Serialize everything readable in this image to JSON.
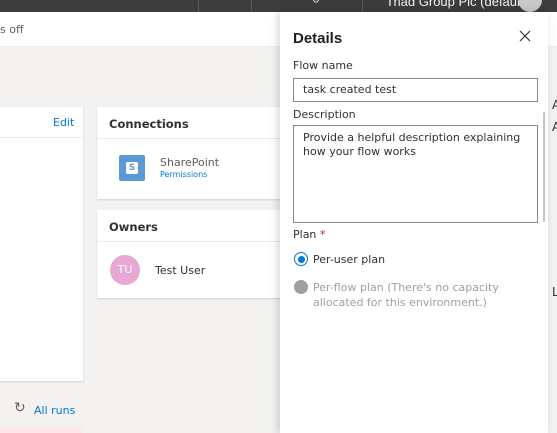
{
  "header": {
    "tenant": "Triad Group Plc (default)",
    "settings_icon": "gear-icon"
  },
  "command_bar": {
    "partial_text": "s off"
  },
  "details_card": {
    "edit_label": "Edit"
  },
  "runs": {
    "all_runs_label": "All runs",
    "refresh_icon": "refresh-icon"
  },
  "connections": {
    "title": "Connections",
    "items": [
      {
        "name": "SharePoint",
        "link": "Permissions",
        "icon": "sharepoint-icon",
        "color": "#5b9bd5"
      }
    ]
  },
  "owners": {
    "title": "Owners",
    "items": [
      {
        "initials": "TU",
        "name": "Test User",
        "color": "#e9a7d3"
      }
    ]
  },
  "edge_fragments": [
    "A",
    "A",
    "L"
  ],
  "panel": {
    "title": "Details",
    "close_icon": "close-icon",
    "flow_name_label": "Flow name",
    "flow_name_value": "task created test",
    "description_label": "Description",
    "description_placeholder": "Provide a helpful description explaining how your flow works",
    "plan_label": "Plan",
    "plan_required": "*",
    "plan_options": [
      {
        "label": "Per-user plan",
        "selected": true,
        "disabled": false
      },
      {
        "label": "Per-flow plan (There's no capacity allocated for this environment.)",
        "selected": false,
        "disabled": true
      }
    ]
  },
  "colors": {
    "accent": "#0078d4",
    "required": "#a4262c",
    "disabled": "#a19f9d"
  }
}
